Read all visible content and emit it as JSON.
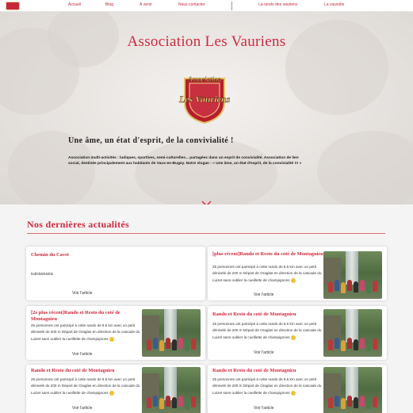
{
  "nav": {
    "items": [
      "Accueil",
      "Blog",
      "À venir",
      "Nous contacter",
      "La rando des vauriens",
      "La vauxolie"
    ]
  },
  "hero": {
    "title": "Association Les Vauriens",
    "tagline": "Une âme, un état d'esprit, de la convivialité !",
    "description": "Association multi-activités : ludiques, sportives, semi-culturelles... partagées dans un esprit de convivialité. Association de lien social, destinée principalement aux habitants de Vaux-en-Bugey. Notre slogan : « Une âme, un état d'esprit, de la convivialité !!! »",
    "crest_text_top": "Association",
    "crest_text_main": "Les Vauriens"
  },
  "news": {
    "title": "Nos dernières actualités",
    "cards": [
      {
        "title": "Chemin du Cavet",
        "text": "fsdfsfdsfdsfds",
        "link": "Voir l'article",
        "has_image": false
      },
      {
        "title": "[plus récent]Rando et Resto du coté de Montagnieu",
        "text": "25 personnes ont participé à cette rando de 8.5 km avec un petit dénivelé de 200 m Départ de Oraglas en direction de la cascade du Luizet sans oublier la cueillette de champignons",
        "link": "Voir l'article",
        "has_image": true
      },
      {
        "title": "[2e plus récent]Rando et Resto du coté de Montagnieu",
        "text": "25 personnes ont participé à cette rando de 8.5 km avec un petit dénivelé de 200 m Départ de Oraglas en direction de la cascade du Luizet sans oublier la cueillette de champignons",
        "link": "Voir l'article",
        "has_image": true
      },
      {
        "title": "Rando et Resto du coté de Montagnieu",
        "text": "25 personnes ont participé à cette rando de 8.5 km avec un petit dénivelé de 200 m Départ de Oraglas en direction de la cascade du Luizet sans oublier la cueillette de champignons",
        "link": "Voir l'article",
        "has_image": true
      },
      {
        "title": "Rando et Resto du coté de Montagnieu",
        "text": "25 personnes ont participé à cette rando de 8.5 km avec un petit dénivelé de 200 m Départ de Oraglas en direction de la cascade du Luizet sans oublier la cueillette de champignons",
        "link": "Voir l'article",
        "has_image": true
      },
      {
        "title": "Rando et Resto du coté de Montagnieu",
        "text": "25 personnes ont participé à cette rando de 8.5 km avec un petit dénivelé de 200 m Départ de Oraglas en direction de la cascade du Luizet sans oublier la cueillette de champignons",
        "link": "Voir l'article",
        "has_image": true
      }
    ]
  },
  "colors": {
    "accent": "#d2283c",
    "background": "#f4f4f4",
    "card": "#ffffff"
  },
  "icons": [
    "logo-icon",
    "crest-icon",
    "chevron-down-icon",
    "emoji-icon"
  ]
}
